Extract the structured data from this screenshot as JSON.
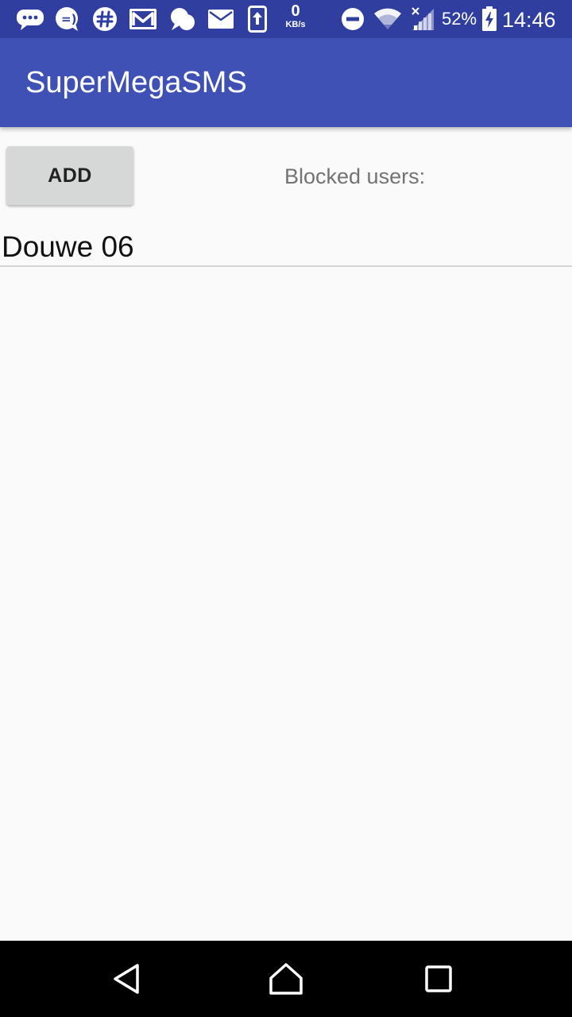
{
  "status_bar": {
    "net_speed_value": "0",
    "net_speed_unit": "KB/s",
    "battery_percent": "52%",
    "time": "14:46"
  },
  "app_bar": {
    "title": "SuperMegaSMS"
  },
  "main": {
    "add_button_label": "ADD",
    "blocked_label": "Blocked users:",
    "blocked_users": [
      "Douwe 06"
    ]
  },
  "nav_bar": {
    "buttons": [
      "back",
      "home",
      "recents"
    ]
  },
  "colors": {
    "status_bar": "#303f9f",
    "app_bar": "#3f51b5",
    "background": "#fafafa",
    "button": "#d6d7d7"
  }
}
